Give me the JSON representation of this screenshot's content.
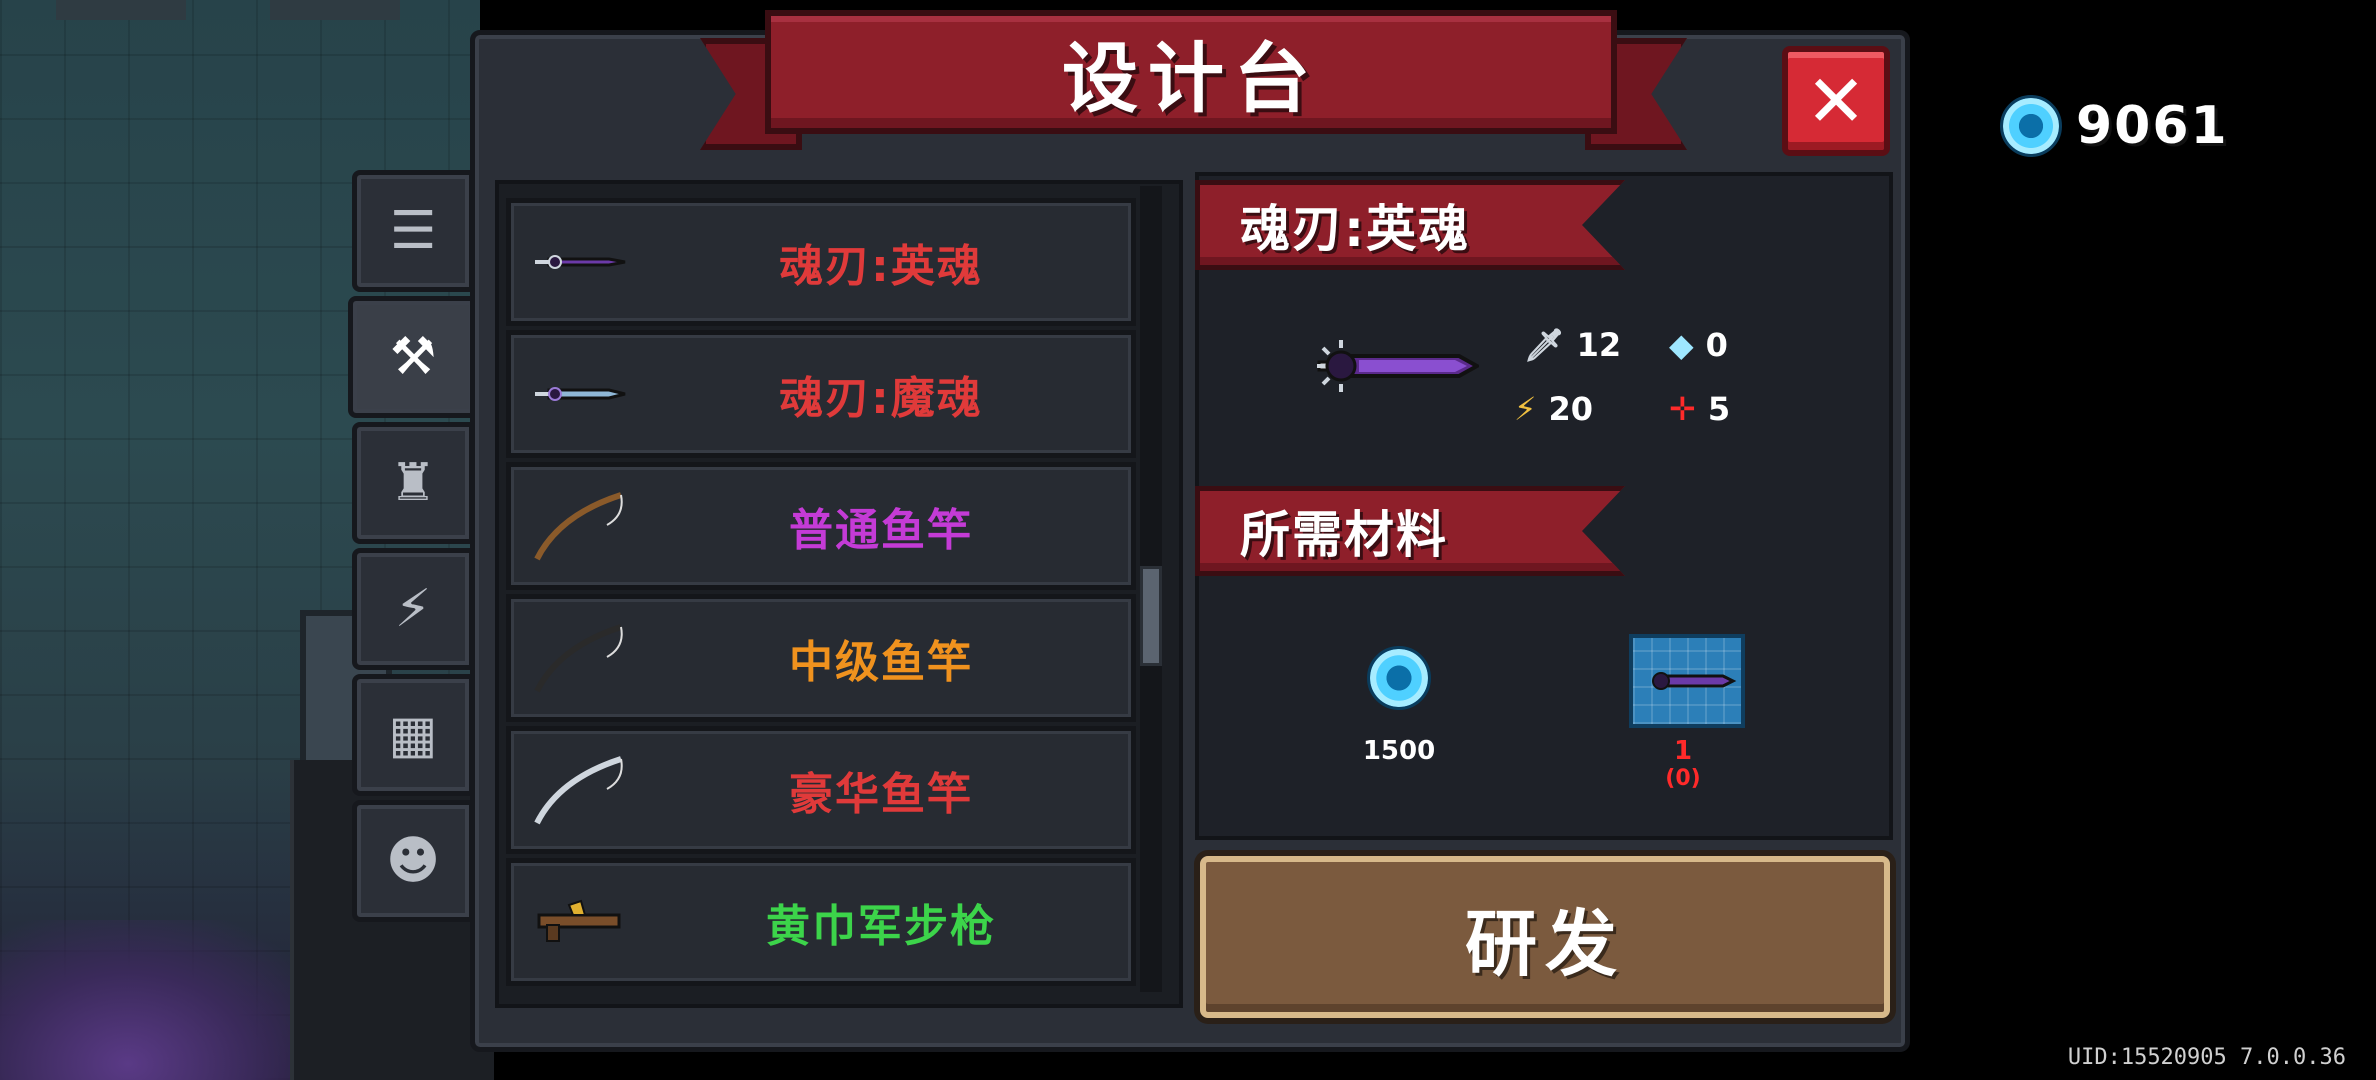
{
  "title": "设计台",
  "currency": {
    "gems": "9061"
  },
  "uid": "UID:15520905 7.0.0.36",
  "tabs": [
    {
      "name": "list-icon",
      "glyph": "☰"
    },
    {
      "name": "weapon-icon",
      "glyph": "⚒"
    },
    {
      "name": "armor-icon",
      "glyph": "♜"
    },
    {
      "name": "lightning-icon",
      "glyph": "⚡"
    },
    {
      "name": "item-icon",
      "glyph": "▦"
    },
    {
      "name": "pet-icon",
      "glyph": "☻"
    }
  ],
  "items": [
    {
      "label": "魂刃:英魂",
      "color": "#e03a3a",
      "icon": "sword-purple-icon"
    },
    {
      "label": "魂刃:魔魂",
      "color": "#e03a3a",
      "icon": "sword-blue-icon"
    },
    {
      "label": "普通鱼竿",
      "color": "#c43bd6",
      "icon": "fishing-rod-icon"
    },
    {
      "label": "中级鱼竿",
      "color": "#f0921e",
      "icon": "fishing-rod-icon"
    },
    {
      "label": "豪华鱼竿",
      "color": "#e03a3a",
      "icon": "fishing-rod-icon"
    },
    {
      "label": "黄巾军步枪",
      "color": "#3cd44a",
      "icon": "rifle-icon"
    }
  ],
  "detail": {
    "name": "魂刃:英魂",
    "stats": {
      "attack": "12",
      "energy": "0",
      "crit": "20",
      "accuracy": "5"
    },
    "materials_title": "所需材料",
    "materials": [
      {
        "name": "gem",
        "amount": "1500",
        "color": "#ffffff"
      },
      {
        "name": "blueprint",
        "amount": "1",
        "owned": "(0)",
        "color": "#ff2a2a"
      }
    ]
  },
  "develop_button": "研发"
}
